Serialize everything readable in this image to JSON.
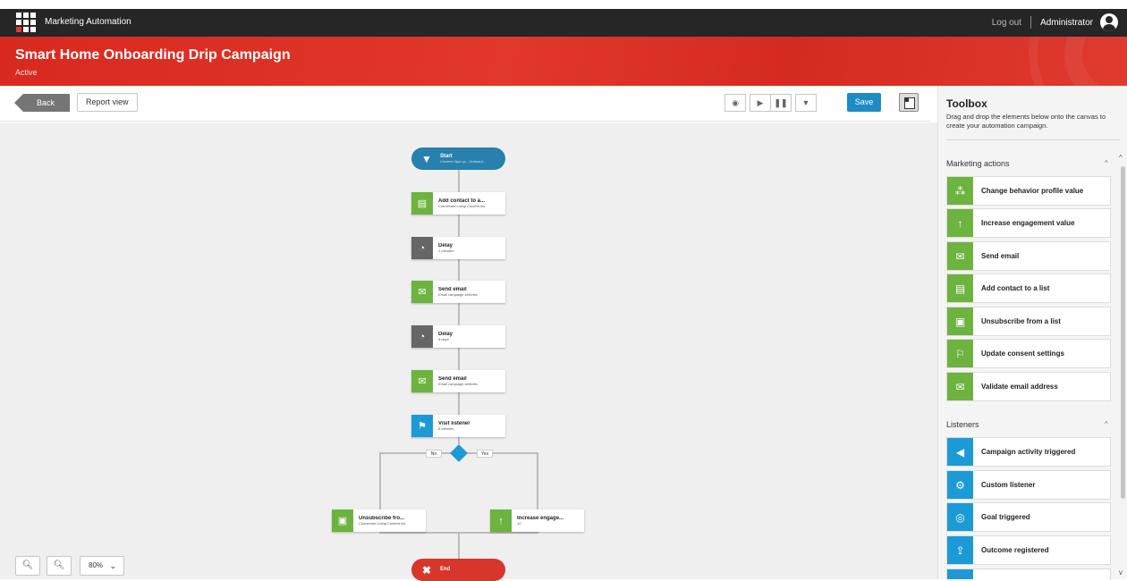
{
  "app": {
    "title": "Marketing Automation",
    "logout": "Log out",
    "user": "Administrator"
  },
  "header": {
    "title": "Smart Home Onboarding Drip Campaign",
    "status": "Active"
  },
  "toolbar": {
    "back": "Back",
    "report_view": "Report view",
    "save": "Save"
  },
  "zoom": {
    "level": "80%",
    "zoom_in": "+",
    "zoom_out": "−"
  },
  "flow": {
    "start": {
      "title": "Start",
      "subtitle": "Content Sign up - Onboard..."
    },
    "nodes": [
      {
        "title": "Add contact to a...",
        "subtitle": "Connected Living Content list",
        "icon": "list-icon"
      },
      {
        "title": "Delay",
        "subtitle": "1 minutes",
        "icon": "clock-icon"
      },
      {
        "title": "Send email",
        "subtitle": "Email campaign selected",
        "icon": "envelope-icon"
      },
      {
        "title": "Delay",
        "subtitle": "9 days",
        "icon": "clock-icon"
      },
      {
        "title": "Send email",
        "subtitle": "Email campaign selected",
        "icon": "envelope-icon"
      },
      {
        "title": "Visit listener",
        "subtitle": "8 minutes",
        "icon": "visit-icon"
      }
    ],
    "branch_no": "No",
    "branch_yes": "Yes",
    "left_branch": {
      "title": "Unsubscribe fro...",
      "subtitle": "Connected Living Content list"
    },
    "right_branch": {
      "title": "Increase engage...",
      "subtitle": "10"
    },
    "end": {
      "title": "End"
    }
  },
  "toolbox": {
    "title": "Toolbox",
    "description": "Drag and drop the elements below onto the canvas to create your automation campaign.",
    "sections": [
      {
        "title": "Marketing actions",
        "items": [
          {
            "label": "Change behavior profile value",
            "icon": "people-icon",
            "color": "#6db33f"
          },
          {
            "label": "Increase engagement value",
            "icon": "arrow-up-icon",
            "color": "#6db33f"
          },
          {
            "label": "Send email",
            "icon": "envelope-icon",
            "color": "#6db33f"
          },
          {
            "label": "Add contact to a list",
            "icon": "list-icon",
            "color": "#6db33f"
          },
          {
            "label": "Unsubscribe from a list",
            "icon": "unsubscribe-icon",
            "color": "#6db33f"
          },
          {
            "label": "Update consent settings",
            "icon": "flag-icon",
            "color": "#6db33f"
          },
          {
            "label": "Validate email address",
            "icon": "validate-email-icon",
            "color": "#6db33f"
          }
        ]
      },
      {
        "title": "Listeners",
        "items": [
          {
            "label": "Campaign activity triggered",
            "icon": "megaphone-icon",
            "color": "#1c9ad6"
          },
          {
            "label": "Custom listener",
            "icon": "gear-icon",
            "color": "#1c9ad6"
          },
          {
            "label": "Goal triggered",
            "icon": "target-icon",
            "color": "#1c9ad6"
          },
          {
            "label": "Outcome registered",
            "icon": "upload-icon",
            "color": "#1c9ad6"
          }
        ]
      }
    ]
  }
}
